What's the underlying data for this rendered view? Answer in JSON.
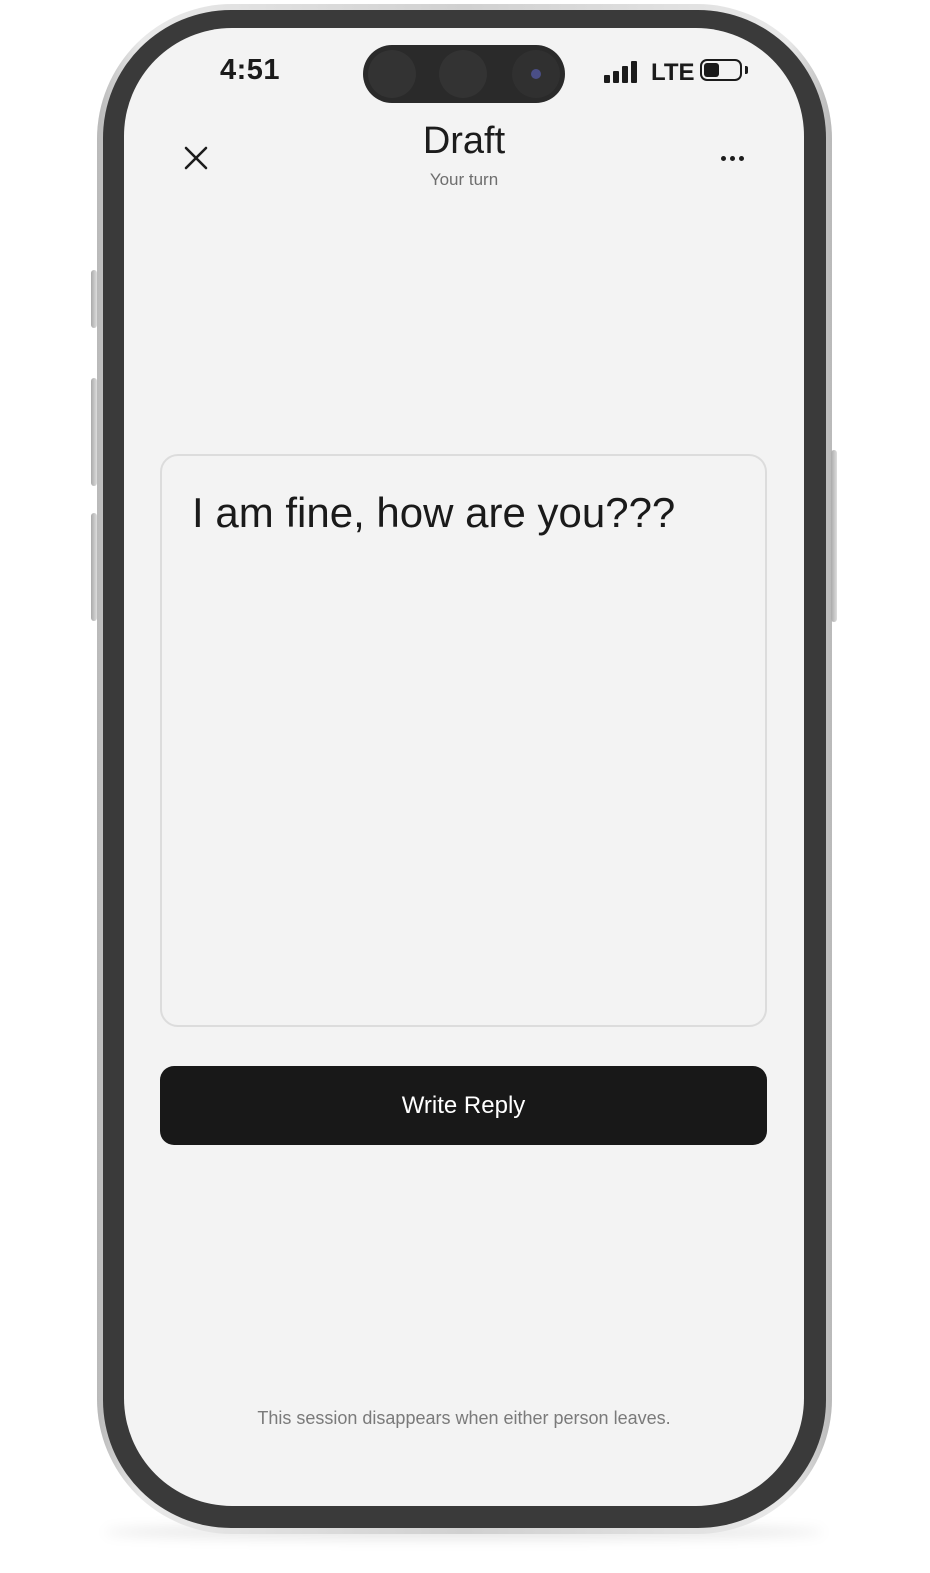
{
  "status_bar": {
    "time": "4:51",
    "network": "LTE",
    "signal_bars": 4,
    "battery_level": 0.45
  },
  "header": {
    "title": "Draft",
    "subtitle": "Your turn",
    "close_icon": "close-icon",
    "more_icon": "more-horizontal-icon"
  },
  "draft": {
    "text": "I am fine, how are you???"
  },
  "actions": {
    "write_reply_label": "Write Reply"
  },
  "footer": {
    "note": "This session disappears when either person leaves."
  },
  "colors": {
    "background": "#f3f3f3",
    "button": "#181818",
    "button_text": "#ffffff"
  }
}
